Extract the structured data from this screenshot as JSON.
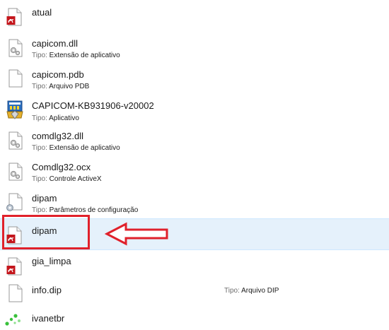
{
  "type_label": "Tipo:",
  "files": [
    {
      "name": "atual",
      "type": "",
      "icon": "pdf-document-icon"
    },
    {
      "name": "capicom.dll",
      "type": "Extensão de aplicativo",
      "icon": "gear-file-icon"
    },
    {
      "name": "capicom.pdb",
      "type": "Arquivo PDB",
      "icon": "blank-file-icon"
    },
    {
      "name": "CAPICOM-KB931906-v20002",
      "type": "Aplicativo",
      "icon": "installer-icon"
    },
    {
      "name": "comdlg32.dll",
      "type": "Extensão de aplicativo",
      "icon": "gear-file-icon"
    },
    {
      "name": "Comdlg32.ocx",
      "type": "Controle ActiveX",
      "icon": "gear-file-icon"
    },
    {
      "name": "dipam",
      "type": "Parâmetros de configuração",
      "icon": "config-file-icon"
    },
    {
      "name": "dipam",
      "type": "",
      "icon": "pdf-document-icon",
      "selected": true
    },
    {
      "name": "gia_limpa",
      "type": "",
      "icon": "pdf-document-icon"
    },
    {
      "name": "info.dip",
      "type": "Arquivo DIP",
      "icon": "blank-file-icon"
    },
    {
      "name": "ivanetbr",
      "type": "",
      "icon": "green-dots-icon"
    }
  ],
  "annotation": {
    "highlight_color": "#e0212b",
    "selected_bg": "#e5f1fb"
  }
}
